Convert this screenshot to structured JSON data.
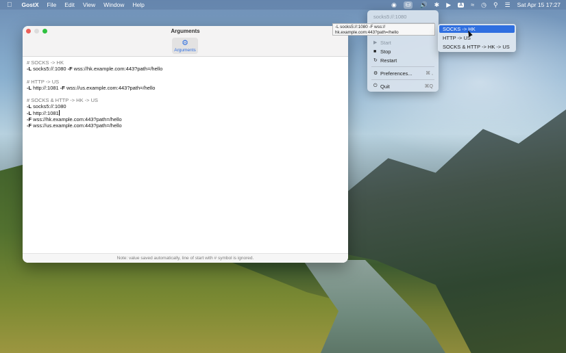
{
  "menubar": {
    "app_name": "GostX",
    "menus": [
      "File",
      "Edit",
      "View",
      "Window",
      "Help"
    ],
    "clock": "Sat Apr 15  17:27",
    "input_source": "A"
  },
  "window": {
    "title": "Arguments",
    "toolbar": {
      "arguments_label": "Arguments"
    },
    "editor_lines": [
      {
        "kind": "comment",
        "text": "# SOCKS -> HK"
      },
      {
        "kind": "code",
        "flag1": "-L",
        "val1": " socks5://:1080 ",
        "flag2": "-F",
        "val2": " wss://hk.example.com:443?path=/hello"
      },
      {
        "kind": "blank"
      },
      {
        "kind": "comment",
        "text": "# HTTP -> US"
      },
      {
        "kind": "code",
        "flag1": "-L",
        "val1": " http://:1081 ",
        "flag2": "-F",
        "val2": " wss://us.example.com:443?path=/hello"
      },
      {
        "kind": "blank"
      },
      {
        "kind": "comment",
        "text": "# SOCKS & HTTP -> HK -> US"
      },
      {
        "kind": "code",
        "flag1": "-L",
        "val1": " socks5://:1080"
      },
      {
        "kind": "code",
        "flag1": "-L",
        "val1": " http://:1081",
        "caret": true
      },
      {
        "kind": "code",
        "flag1": "-F",
        "val1": " wss://hk.example.com:443?path=/hello"
      },
      {
        "kind": "code",
        "flag1": "-F",
        "val1": " wss://us.example.com:443?path=/hello"
      }
    ],
    "footer_note": "Note: value saved automatically, line of start with # symbol is ignored."
  },
  "dropdown": {
    "current": "socks5://:1080",
    "start": "Start",
    "stop": "Stop",
    "restart": "Restart",
    "preferences": "Preferences...",
    "preferences_shortcut": "⌘ ,",
    "quit": "Quit",
    "quit_shortcut": "⌘Q"
  },
  "tooltip": {
    "line1": "-L socks5://:1080 -F wss://",
    "line2": "hk.example.com:443?path=/hello"
  },
  "submenu": {
    "items": [
      "SOCKS -> HK",
      "HTTP -> US",
      "SOCKS & HTTP -> HK -> US"
    ]
  }
}
